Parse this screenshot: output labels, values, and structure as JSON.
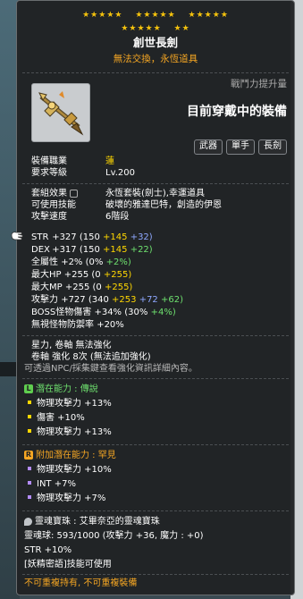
{
  "item": {
    "stars_row1": [
      "★★★★★",
      "★★★★★",
      "★★★★★"
    ],
    "stars_row2": [
      "★★★★★",
      "★★"
    ],
    "name": "創世長劍",
    "trade_info": "無法交換，永恆道具",
    "power_label": "戰鬥力提升量",
    "equipped_text": "目前穿戴中的裝備",
    "tags": [
      "武器",
      "單手",
      "長劍"
    ],
    "job_label": "裝備職業",
    "job_value": "蓮",
    "level_label": "要求等級",
    "level_value": "Lv.200"
  },
  "info": {
    "set_label": "套組效果",
    "set_value": "永恆套裝(劍士),幸運道具",
    "skill_label": "可使用技能",
    "skill_value": "破壞的雅達巴特，創造的伊恩",
    "speed_label": "攻擊速度",
    "speed_value": "6階段"
  },
  "stats": [
    {
      "label": "STR",
      "total": "+327",
      "open": "(150",
      "a": "+145",
      "b": "+32)",
      "c": ""
    },
    {
      "label": "DEX",
      "total": "+317",
      "open": "(150",
      "a": "+145",
      "b": "+22)",
      "c": ""
    },
    {
      "label": "全屬性",
      "total": "+2%",
      "open": "(0%",
      "a": "",
      "b": "",
      "c": "+2%)"
    },
    {
      "label": "最大HP",
      "total": "+255",
      "open": "(0",
      "a": "+255)",
      "b": "",
      "c": ""
    },
    {
      "label": "最大MP",
      "total": "+255",
      "open": "(0",
      "a": "+255)",
      "b": "",
      "c": ""
    },
    {
      "label": "攻擊力",
      "total": "+727",
      "open": "(340",
      "a": "+253",
      "b": "+72",
      "c": "+62)"
    },
    {
      "label": "BOSS怪物傷害",
      "total": "+34%",
      "open": "(30%",
      "a": "",
      "b": "",
      "c": "+4%)"
    },
    {
      "label": "無視怪物防禦率",
      "total": "+20%",
      "open": "",
      "a": "",
      "b": "",
      "c": ""
    }
  ],
  "enhance": {
    "star_line": "星力, 卷軸 無法強化",
    "scroll_line": "卷軸 強化 8次 (無法追加強化)",
    "npc_line": "可透過NPC/採集鍵查看強化資訊詳細內容。"
  },
  "potential": {
    "title": "潛在能力 : 傳說",
    "badge": "L",
    "lines": [
      "物理攻擊力 +13%",
      "傷害 +10%",
      "物理攻擊力 +13%"
    ]
  },
  "additional": {
    "title": "附加潛在能力 : 罕見",
    "badge": "R",
    "lines": [
      "物理攻擊力 +10%",
      "INT +7%",
      "物理攻擊力 +7%"
    ]
  },
  "soul": {
    "title": "靈魂寶珠 : 艾畢奈亞的靈魂寶珠",
    "value_line": "靈魂球:  593/1000 (攻擊力 +36, 魔力 : +0)",
    "str_line": "STR +10%",
    "skill_line": "[妖精密語]技能可使用"
  },
  "footer": {
    "duplicate": "不可重複持有, 不可重複裝備"
  },
  "colors": {
    "star": "#f4c20d",
    "scroll_orange": "#f5a623",
    "star_blue": "#8fa8ff",
    "bonus_green": "#6ee06e",
    "legend_green": "#5fce4f"
  }
}
